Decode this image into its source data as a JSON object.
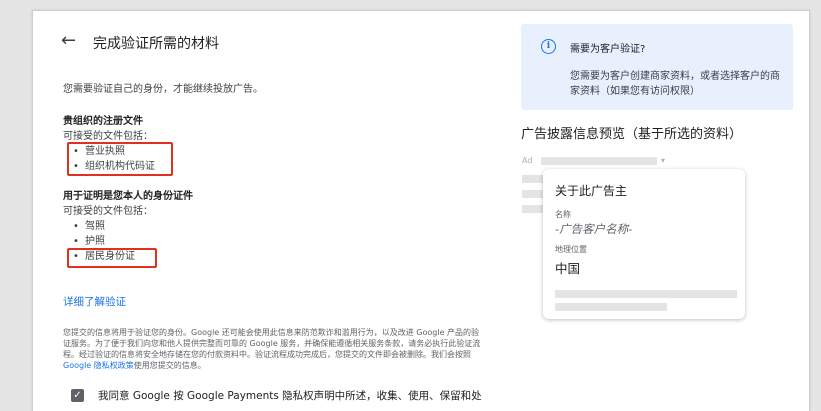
{
  "header": {
    "title": "完成验证所需的材料"
  },
  "intro": "您需要验证自己的身份，才能继续投放广告。",
  "org_docs": {
    "title": "贵组织的注册文件",
    "subtitle": "可接受的文件包括：",
    "items": [
      "营业执照",
      "组织机构代码证"
    ]
  },
  "id_docs": {
    "title": "用于证明是您本人的身份证件",
    "subtitle": "可接受的文件包括：",
    "items": [
      "驾照",
      "护照",
      "居民身份证"
    ]
  },
  "learn_more": "详细了解验证",
  "fine_print": {
    "part1": "您提交的信息将用于验证您的身份。Google 还可能会使用此信息来防范欺诈和滥用行为，以及改进 Google 产品的验证服务。为了便于我们向您和他人提供完整而可靠的 Google 服务，并确保能遵循相关服务条款，请务必执行此验证流程。经过验证的信息将安全地存储在您的付款资料中。验证流程成功完成后，您提交的文件即会被删除。我们会按照 ",
    "link": "Google 隐私权政策",
    "part2": "使用您提交的信息。"
  },
  "agree_text": "我同意 Google 按 Google Payments 隐私权声明中所述，收集、使用、保留和处",
  "info_card": {
    "title": "需要为客户验证?",
    "text": "您需要为客户创建商家资料，或者选择客户的商家资料（如果您有访问权限）"
  },
  "preview": {
    "heading": "广告披露信息预览（基于所选的资料）",
    "ad_label": "Ad",
    "card": {
      "title": "关于此广告主",
      "name_label": "名称",
      "name_value": "-广告客户名称-",
      "location_label": "地理位置",
      "location_value": "中国"
    }
  },
  "colors": {
    "accent": "#1a73e8",
    "highlight": "#e0301e",
    "info_bg": "#e8f0fe"
  },
  "icons": {
    "back": "arrow-left-icon",
    "info": "info-icon",
    "checkbox": "check-icon"
  }
}
